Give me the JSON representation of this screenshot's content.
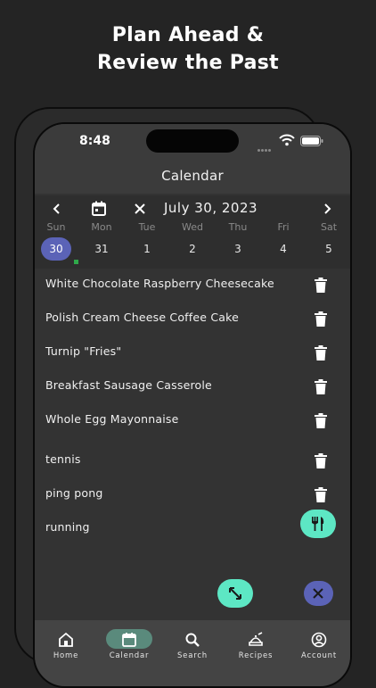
{
  "headline": {
    "line1": "Plan Ahead &",
    "line2": "Review the Past"
  },
  "status": {
    "time": "8:48"
  },
  "appbar": {
    "title": "Calendar"
  },
  "calendar": {
    "date_title": "July 30, 2023",
    "weekdays": [
      "Sun",
      "Mon",
      "Tue",
      "Wed",
      "Thu",
      "Fri",
      "Sat"
    ],
    "days": [
      "30",
      "31",
      "1",
      "2",
      "3",
      "4",
      "5"
    ],
    "selected_index": 0
  },
  "meals": [
    "White Chocolate Raspberry Cheesecake",
    "Polish Cream Cheese Coffee Cake",
    "Turnip \"Fries\"",
    "Breakfast Sausage Casserole",
    "Whole Egg Mayonnaise"
  ],
  "activities": [
    "tennis",
    "ping pong",
    "running"
  ],
  "nav": [
    "Home",
    "Calendar",
    "Search",
    "Recipes",
    "Account"
  ],
  "colors": {
    "accent_mint": "#5de7c4",
    "accent_indigo": "#5b63b7",
    "nav_active": "#5a8a7c",
    "dot_green": "#2fa94a"
  }
}
